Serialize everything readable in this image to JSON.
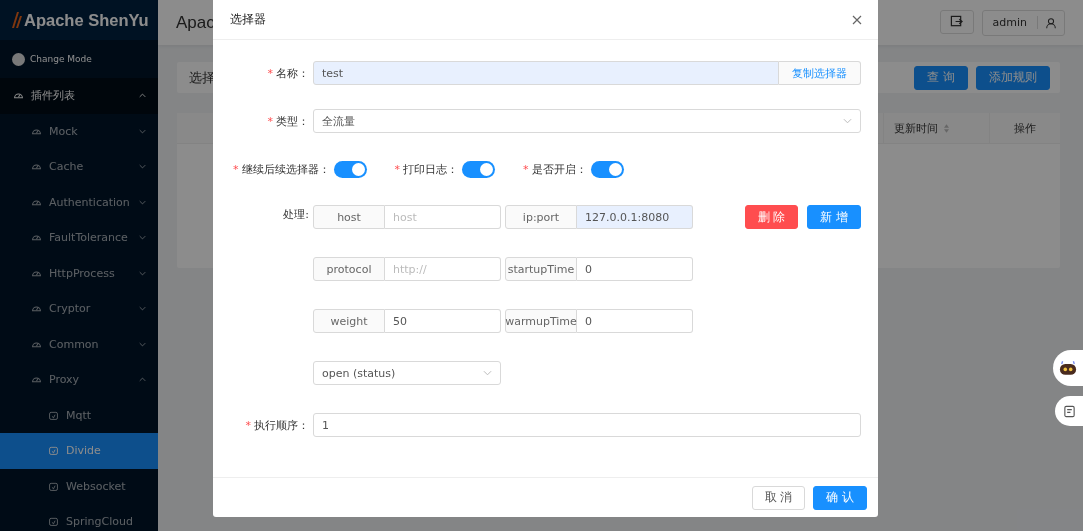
{
  "sidebar": {
    "logo": "Apache ShenYu",
    "change_mode": "Change Mode",
    "menu": [
      {
        "label": "插件列表",
        "expanded": true,
        "children": [
          {
            "label": "Mock",
            "expanded": false
          },
          {
            "label": "Cache",
            "expanded": false
          },
          {
            "label": "Authentication",
            "expanded": false
          },
          {
            "label": "FaultTolerance",
            "expanded": false
          },
          {
            "label": "HttpProcess",
            "expanded": false
          },
          {
            "label": "Cryptor",
            "expanded": false
          },
          {
            "label": "Common",
            "expanded": false
          },
          {
            "label": "Proxy",
            "expanded": true,
            "children": [
              {
                "label": "Mqtt",
                "selected": false
              },
              {
                "label": "Divide",
                "selected": true
              },
              {
                "label": "Websocket",
                "selected": false
              },
              {
                "label": "SpringCloud",
                "selected": false
              }
            ]
          }
        ]
      }
    ]
  },
  "header": {
    "title": "Apac",
    "user": "admin"
  },
  "toolbar": {
    "label": "选择",
    "buttons": [
      "查 询",
      "添加规则"
    ]
  },
  "table": {
    "columns": [
      {
        "label": "更新时间",
        "sortable": true
      },
      {
        "label": "操作",
        "sortable": false
      }
    ]
  },
  "dialog": {
    "title": "选择器",
    "name": {
      "required_mark": "*",
      "label": "名称：",
      "value": "test",
      "autofilled": true,
      "addon": "复制选择器"
    },
    "type": {
      "required_mark": "*",
      "label": "类型：",
      "value": "全流量"
    },
    "switches": [
      {
        "required_mark": "*",
        "label": "继续后续选择器：",
        "on": true
      },
      {
        "required_mark": "*",
        "label": "打印日志：",
        "on": true
      },
      {
        "required_mark": "*",
        "label": "是否开启：",
        "on": true
      }
    ],
    "handle": {
      "label": "处理:",
      "rows": [
        [
          {
            "addon": "host",
            "placeholder": "host",
            "autofilled": false
          },
          {
            "addon": "ip:port",
            "value": "127.0.0.1:8080",
            "autofilled": true
          }
        ],
        [
          {
            "addon": "protocol",
            "placeholder": "http://",
            "autofilled": false
          },
          {
            "addon": "startupTime",
            "value": "0",
            "autofilled": false
          }
        ],
        [
          {
            "addon": "weight",
            "value": "50",
            "autofilled": false
          },
          {
            "addon": "warmupTime",
            "value": "0",
            "autofilled": false
          }
        ]
      ],
      "status": "open (status)",
      "buttons": [
        {
          "label": "删 除",
          "kind": "danger"
        },
        {
          "label": "新 增",
          "kind": "primary"
        }
      ]
    },
    "order": {
      "required_mark": "*",
      "label": "执行顺序：",
      "value": "1"
    },
    "footer": [
      {
        "label": "取 消",
        "kind": "default"
      },
      {
        "label": "确 认",
        "kind": "primary"
      }
    ]
  }
}
